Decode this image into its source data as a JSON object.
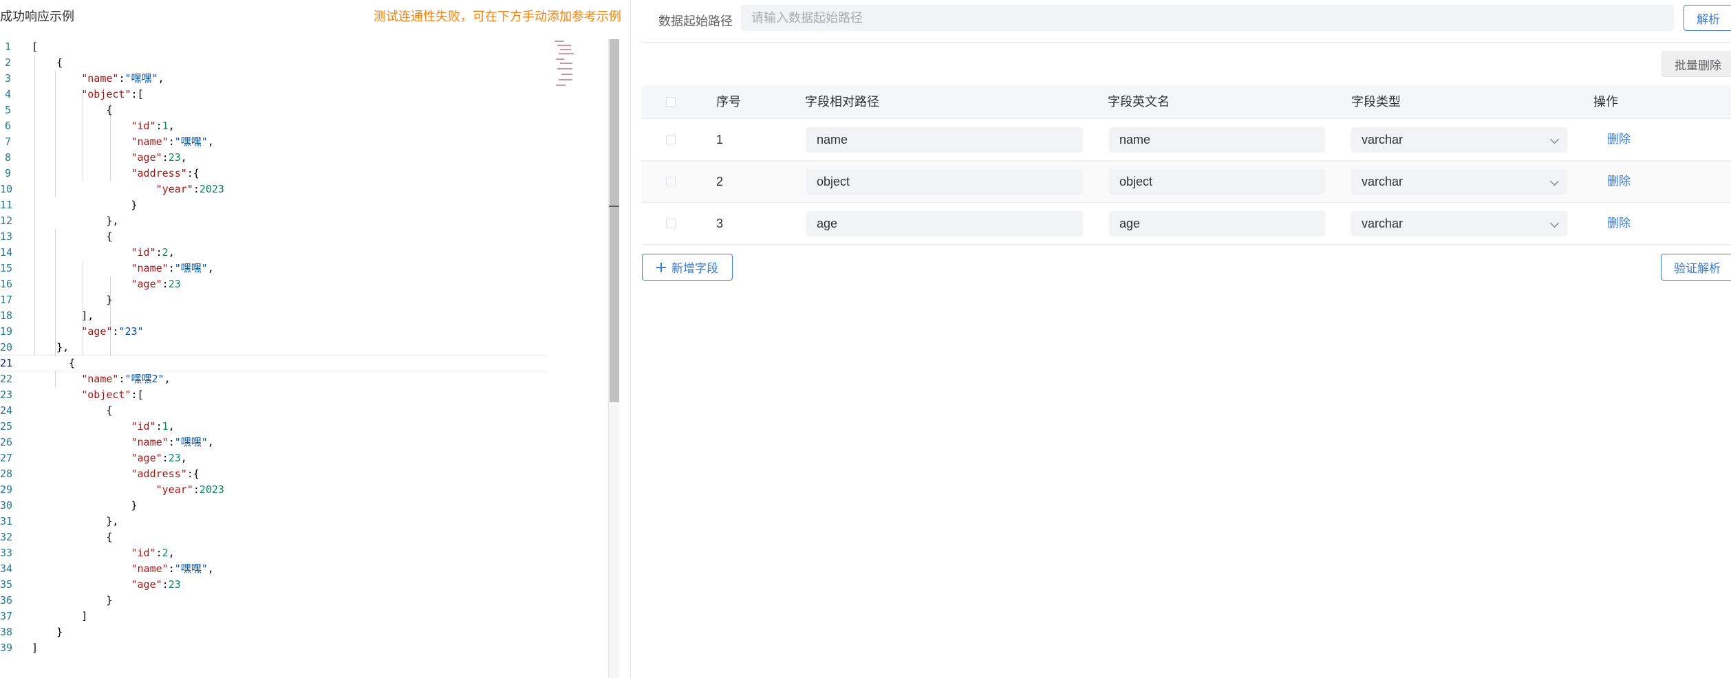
{
  "left_panel": {
    "title": "成功响应示例",
    "warning": "测试连通性失败，可在下方手动添加参考示例",
    "active_line": 21,
    "lines": [
      {
        "n": "1",
        "t": [
          [
            "p",
            "["
          ]
        ]
      },
      {
        "n": "2",
        "t": [
          [
            "p",
            "    {"
          ]
        ]
      },
      {
        "n": "3",
        "t": [
          [
            "p",
            "        "
          ],
          [
            "k",
            "\"name\""
          ],
          [
            "p",
            ":"
          ],
          [
            "s",
            "\"嘿嘿\""
          ],
          [
            "p",
            ","
          ]
        ]
      },
      {
        "n": "4",
        "t": [
          [
            "p",
            "        "
          ],
          [
            "k",
            "\"object\""
          ],
          [
            "p",
            ":["
          ]
        ]
      },
      {
        "n": "5",
        "t": [
          [
            "p",
            "            {"
          ]
        ]
      },
      {
        "n": "6",
        "t": [
          [
            "p",
            "                "
          ],
          [
            "k",
            "\"id\""
          ],
          [
            "p",
            ":"
          ],
          [
            "n",
            "1"
          ],
          [
            "p",
            ","
          ]
        ]
      },
      {
        "n": "7",
        "t": [
          [
            "p",
            "                "
          ],
          [
            "k",
            "\"name\""
          ],
          [
            "p",
            ":"
          ],
          [
            "s",
            "\"嘿嘿\""
          ],
          [
            "p",
            ","
          ]
        ]
      },
      {
        "n": "8",
        "t": [
          [
            "p",
            "                "
          ],
          [
            "k",
            "\"age\""
          ],
          [
            "p",
            ":"
          ],
          [
            "n",
            "23"
          ],
          [
            "p",
            ","
          ]
        ]
      },
      {
        "n": "9",
        "t": [
          [
            "p",
            "                "
          ],
          [
            "k",
            "\"address\""
          ],
          [
            "p",
            ":{"
          ]
        ]
      },
      {
        "n": "10",
        "t": [
          [
            "p",
            "                    "
          ],
          [
            "k",
            "\"year\""
          ],
          [
            "p",
            ":"
          ],
          [
            "n",
            "2023"
          ]
        ]
      },
      {
        "n": "11",
        "t": [
          [
            "p",
            "                }"
          ]
        ]
      },
      {
        "n": "12",
        "t": [
          [
            "p",
            "            },"
          ]
        ]
      },
      {
        "n": "13",
        "t": [
          [
            "p",
            "            {"
          ]
        ]
      },
      {
        "n": "14",
        "t": [
          [
            "p",
            "                "
          ],
          [
            "k",
            "\"id\""
          ],
          [
            "p",
            ":"
          ],
          [
            "n",
            "2"
          ],
          [
            "p",
            ","
          ]
        ]
      },
      {
        "n": "15",
        "t": [
          [
            "p",
            "                "
          ],
          [
            "k",
            "\"name\""
          ],
          [
            "p",
            ":"
          ],
          [
            "s",
            "\"嘿嘿\""
          ],
          [
            "p",
            ","
          ]
        ]
      },
      {
        "n": "16",
        "t": [
          [
            "p",
            "                "
          ],
          [
            "k",
            "\"age\""
          ],
          [
            "p",
            ":"
          ],
          [
            "n",
            "23"
          ]
        ]
      },
      {
        "n": "17",
        "t": [
          [
            "p",
            "            }"
          ]
        ]
      },
      {
        "n": "18",
        "t": [
          [
            "p",
            "        ],"
          ]
        ]
      },
      {
        "n": "19",
        "t": [
          [
            "p",
            "        "
          ],
          [
            "k",
            "\"age\""
          ],
          [
            "p",
            ":"
          ],
          [
            "s",
            "\"23\""
          ]
        ]
      },
      {
        "n": "20",
        "t": [
          [
            "p",
            "    },"
          ]
        ]
      },
      {
        "n": "21",
        "t": [
          [
            "p",
            "      {"
          ]
        ]
      },
      {
        "n": "22",
        "t": [
          [
            "p",
            "        "
          ],
          [
            "k",
            "\"name\""
          ],
          [
            "p",
            ":"
          ],
          [
            "s",
            "\"嘿嘿2\""
          ],
          [
            "p",
            ","
          ]
        ]
      },
      {
        "n": "23",
        "t": [
          [
            "p",
            "        "
          ],
          [
            "k",
            "\"object\""
          ],
          [
            "p",
            ":["
          ]
        ]
      },
      {
        "n": "24",
        "t": [
          [
            "p",
            "            {"
          ]
        ]
      },
      {
        "n": "25",
        "t": [
          [
            "p",
            "                "
          ],
          [
            "k",
            "\"id\""
          ],
          [
            "p",
            ":"
          ],
          [
            "n",
            "1"
          ],
          [
            "p",
            ","
          ]
        ]
      },
      {
        "n": "26",
        "t": [
          [
            "p",
            "                "
          ],
          [
            "k",
            "\"name\""
          ],
          [
            "p",
            ":"
          ],
          [
            "s",
            "\"嘿嘿\""
          ],
          [
            "p",
            ","
          ]
        ]
      },
      {
        "n": "27",
        "t": [
          [
            "p",
            "                "
          ],
          [
            "k",
            "\"age\""
          ],
          [
            "p",
            ":"
          ],
          [
            "n",
            "23"
          ],
          [
            "p",
            ","
          ]
        ]
      },
      {
        "n": "28",
        "t": [
          [
            "p",
            "                "
          ],
          [
            "k",
            "\"address\""
          ],
          [
            "p",
            ":{"
          ]
        ]
      },
      {
        "n": "29",
        "t": [
          [
            "p",
            "                    "
          ],
          [
            "k",
            "\"year\""
          ],
          [
            "p",
            ":"
          ],
          [
            "n",
            "2023"
          ]
        ]
      },
      {
        "n": "30",
        "t": [
          [
            "p",
            "                }"
          ]
        ]
      },
      {
        "n": "31",
        "t": [
          [
            "p",
            "            },"
          ]
        ]
      },
      {
        "n": "32",
        "t": [
          [
            "p",
            "            {"
          ]
        ]
      },
      {
        "n": "33",
        "t": [
          [
            "p",
            "                "
          ],
          [
            "k",
            "\"id\""
          ],
          [
            "p",
            ":"
          ],
          [
            "n",
            "2"
          ],
          [
            "p",
            ","
          ]
        ]
      },
      {
        "n": "34",
        "t": [
          [
            "p",
            "                "
          ],
          [
            "k",
            "\"name\""
          ],
          [
            "p",
            ":"
          ],
          [
            "s",
            "\"嘿嘿\""
          ],
          [
            "p",
            ","
          ]
        ]
      },
      {
        "n": "35",
        "t": [
          [
            "p",
            "                "
          ],
          [
            "k",
            "\"age\""
          ],
          [
            "p",
            ":"
          ],
          [
            "n",
            "23"
          ]
        ]
      },
      {
        "n": "36",
        "t": [
          [
            "p",
            "            }"
          ]
        ]
      },
      {
        "n": "37",
        "t": [
          [
            "p",
            "        ]"
          ]
        ]
      },
      {
        "n": "38",
        "t": [
          [
            "p",
            "    }"
          ]
        ]
      },
      {
        "n": "39",
        "t": [
          [
            "p",
            "]"
          ]
        ]
      }
    ]
  },
  "right_panel": {
    "path_label": "数据起始路径",
    "path_value": "",
    "path_placeholder": "请输入数据起始路径",
    "parse_label": "解析",
    "batch_delete_label": "批量删除",
    "columns": {
      "index": "序号",
      "path": "字段相对路径",
      "name": "字段英文名",
      "type": "字段类型",
      "action": "操作"
    },
    "rows": [
      {
        "index": "1",
        "path": "name",
        "name": "name",
        "type": "varchar",
        "action": "删除"
      },
      {
        "index": "2",
        "path": "object",
        "name": "object",
        "type": "varchar",
        "action": "删除"
      },
      {
        "index": "3",
        "path": "age",
        "name": "age",
        "type": "varchar",
        "action": "删除"
      }
    ],
    "add_field_label": "新增字段",
    "verify_label": "验证解析"
  },
  "colors": {
    "accent": "#3b7bd6",
    "warning": "#f5820a",
    "json_key": "#a31515",
    "json_string": "#0451a5",
    "json_number": "#098658",
    "line_number": "#237893"
  },
  "icons": [
    "plus-icon",
    "chevron-down-icon"
  ]
}
